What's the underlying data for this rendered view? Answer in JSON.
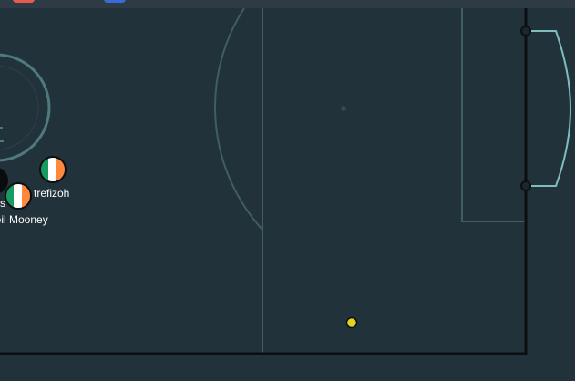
{
  "game": {
    "players": [
      {
        "name": "trefizoh",
        "team_flag": "ireland"
      },
      {
        "name": "Neil Mooney",
        "team_flag": "ireland"
      },
      {
        "name": "s",
        "team_flag": "black"
      }
    ],
    "ball": {
      "color": "#e3d51e"
    },
    "colors": {
      "pitch": "#22323a",
      "lines": "#4e7a7f",
      "goal": "#7fbcbf",
      "boundary": "#0b0f12",
      "flag_green": "#169b62",
      "flag_white": "#ffffff",
      "flag_orange": "#ff883e"
    }
  }
}
